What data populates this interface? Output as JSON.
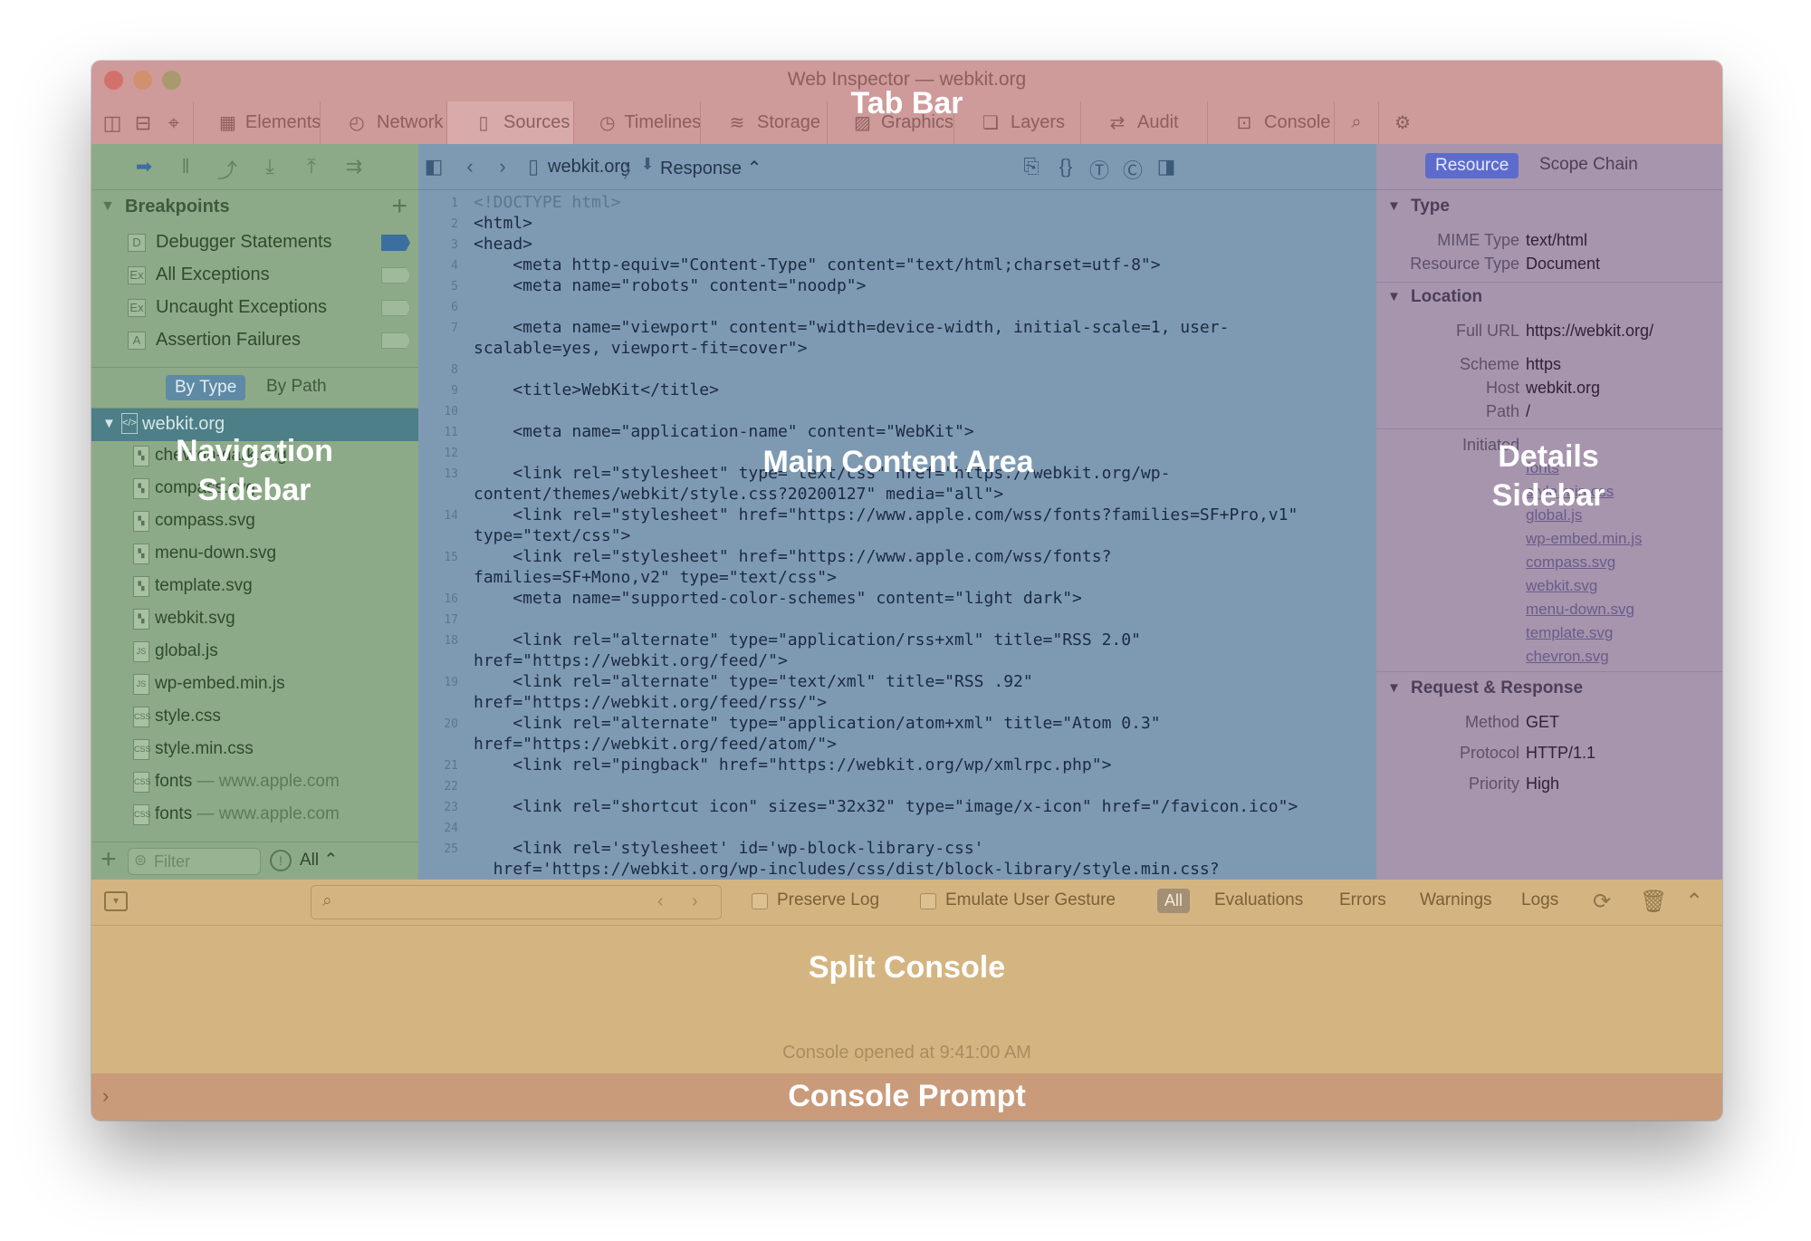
{
  "window": {
    "title": "Web Inspector — webkit.org"
  },
  "tabbar": {
    "tabs": [
      {
        "label": "Elements",
        "icon": "elements-icon"
      },
      {
        "label": "Network",
        "icon": "network-icon"
      },
      {
        "label": "Sources",
        "icon": "sources-icon",
        "active": true
      },
      {
        "label": "Timelines",
        "icon": "timelines-icon"
      },
      {
        "label": "Storage",
        "icon": "storage-icon"
      },
      {
        "label": "Graphics",
        "icon": "graphics-icon"
      },
      {
        "label": "Layers",
        "icon": "layers-icon"
      },
      {
        "label": "Audit",
        "icon": "audit-icon"
      },
      {
        "label": "Console",
        "icon": "console-icon"
      }
    ]
  },
  "overlay_labels": {
    "tab_bar": "Tab Bar",
    "navigation_sidebar": "Navigation Sidebar",
    "main_content": "Main Content Area",
    "details_sidebar": "Details Sidebar",
    "split_console": "Split Console",
    "console_prompt": "Console Prompt"
  },
  "nav": {
    "breakpoints_title": "Breakpoints",
    "breakpoints": [
      {
        "label": "Debugger Statements",
        "badge": "D",
        "enabled": true
      },
      {
        "label": "All Exceptions",
        "badge": "Ex",
        "enabled": false
      },
      {
        "label": "Uncaught Exceptions",
        "badge": "Ex",
        "enabled": false
      },
      {
        "label": "Assertion Failures",
        "badge": "A",
        "enabled": false
      }
    ],
    "group_by": {
      "by_type": "By Type",
      "by_path": "By Path"
    },
    "root": "webkit.org",
    "files": [
      {
        "name": "chevron-dark.svg",
        "kind": "svg"
      },
      {
        "name": "compass.svg",
        "kind": "svg"
      },
      {
        "name": "compass.svg",
        "kind": "svg"
      },
      {
        "name": "menu-down.svg",
        "kind": "svg"
      },
      {
        "name": "template.svg",
        "kind": "svg"
      },
      {
        "name": "webkit.svg",
        "kind": "svg"
      },
      {
        "name": "global.js",
        "kind": "JS"
      },
      {
        "name": "wp-embed.min.js",
        "kind": "JS"
      },
      {
        "name": "style.css",
        "kind": "CSS"
      },
      {
        "name": "style.min.css",
        "kind": "CSS"
      },
      {
        "name": "fonts",
        "domain": "— www.apple.com",
        "kind": "CSS"
      },
      {
        "name": "fonts",
        "domain": "— www.apple.com",
        "kind": "CSS"
      }
    ],
    "filter_placeholder": "Filter",
    "filter_scope": "All"
  },
  "main": {
    "breadcrumb": {
      "resource": "webkit.org",
      "mode": "Response"
    },
    "lines": [
      {
        "n": "1",
        "t": "<!DOCTYPE html>",
        "dim": true
      },
      {
        "n": "2",
        "t": "<html>"
      },
      {
        "n": "3",
        "t": "<head>"
      },
      {
        "n": "4",
        "t": "    <meta http-equiv=\"Content-Type\" content=\"text/html;charset=utf-8\">"
      },
      {
        "n": "5",
        "t": "    <meta name=\"robots\" content=\"noodp\">"
      },
      {
        "n": "6",
        "t": ""
      },
      {
        "n": "7",
        "t": "    <meta name=\"viewport\" content=\"width=device-width, initial-scale=1, user-"
      },
      {
        "n": "",
        "t": "scalable=yes, viewport-fit=cover\">"
      },
      {
        "n": "8",
        "t": ""
      },
      {
        "n": "9",
        "t": "    <title>WebKit</title>"
      },
      {
        "n": "10",
        "t": ""
      },
      {
        "n": "11",
        "t": "    <meta name=\"application-name\" content=\"WebKit\">"
      },
      {
        "n": "12",
        "t": ""
      },
      {
        "n": "13",
        "t": "    <link rel=\"stylesheet\" type=\"text/css\" href=\"https://webkit.org/wp-"
      },
      {
        "n": "",
        "t": "content/themes/webkit/style.css?20200127\" media=\"all\">"
      },
      {
        "n": "14",
        "t": "    <link rel=\"stylesheet\" href=\"https://www.apple.com/wss/fonts?families=SF+Pro,v1\""
      },
      {
        "n": "",
        "t": "type=\"text/css\">"
      },
      {
        "n": "15",
        "t": "    <link rel=\"stylesheet\" href=\"https://www.apple.com/wss/fonts?"
      },
      {
        "n": "",
        "t": "families=SF+Mono,v2\" type=\"text/css\">"
      },
      {
        "n": "16",
        "t": "    <meta name=\"supported-color-schemes\" content=\"light dark\">"
      },
      {
        "n": "17",
        "t": ""
      },
      {
        "n": "18",
        "t": "    <link rel=\"alternate\" type=\"application/rss+xml\" title=\"RSS 2.0\""
      },
      {
        "n": "",
        "t": "href=\"https://webkit.org/feed/\">"
      },
      {
        "n": "19",
        "t": "    <link rel=\"alternate\" type=\"text/xml\" title=\"RSS .92\""
      },
      {
        "n": "",
        "t": "href=\"https://webkit.org/feed/rss/\">"
      },
      {
        "n": "20",
        "t": "    <link rel=\"alternate\" type=\"application/atom+xml\" title=\"Atom 0.3\""
      },
      {
        "n": "",
        "t": "href=\"https://webkit.org/feed/atom/\">"
      },
      {
        "n": "21",
        "t": "    <link rel=\"pingback\" href=\"https://webkit.org/wp/xmlrpc.php\">"
      },
      {
        "n": "22",
        "t": ""
      },
      {
        "n": "23",
        "t": "    <link rel=\"shortcut icon\" sizes=\"32x32\" type=\"image/x-icon\" href=\"/favicon.ico\">"
      },
      {
        "n": "24",
        "t": ""
      },
      {
        "n": "25",
        "t": "    <link rel='stylesheet' id='wp-block-library-css'"
      },
      {
        "n": "",
        "t": "  href='https://webkit.org/wp-includes/css/dist/block-library/style.min.css?"
      }
    ]
  },
  "details": {
    "tabs": {
      "resource": "Resource",
      "scope_chain": "Scope Chain"
    },
    "type": {
      "title": "Type",
      "rows": [
        {
          "k": "MIME Type",
          "v": "text/html"
        },
        {
          "k": "Resource Type",
          "v": "Document"
        }
      ]
    },
    "location": {
      "title": "Location",
      "rows": [
        {
          "k": "Full URL",
          "v": "https://webkit.org/"
        },
        {
          "k": "Scheme",
          "v": "https"
        },
        {
          "k": "Host",
          "v": "webkit.org"
        },
        {
          "k": "Path",
          "v": "/"
        }
      ]
    },
    "initiated_label": "Initiated",
    "initiated": [
      "fonts",
      "style.min.css",
      "global.js",
      "wp-embed.min.js",
      "compass.svg",
      "webkit.svg",
      "menu-down.svg",
      "template.svg",
      "chevron.svg"
    ],
    "request": {
      "title": "Request & Response",
      "rows": [
        {
          "k": "Method",
          "v": "GET"
        },
        {
          "k": "Protocol",
          "v": "HTTP/1.1"
        },
        {
          "k": "Priority",
          "v": "High"
        }
      ]
    }
  },
  "console": {
    "search_placeholder": "",
    "preserve_log": "Preserve Log",
    "emulate_gesture": "Emulate User Gesture",
    "filters": [
      "All",
      "Evaluations",
      "Errors",
      "Warnings",
      "Logs"
    ],
    "message": "Console opened at 9:41:00 AM"
  },
  "colors": {
    "tab_bar": "#ce9a9a",
    "navigation_sidebar": "#8daa88",
    "main_content": "#7e9ab3",
    "details_sidebar": "#a695ad",
    "split_console": "#d4b581",
    "console_prompt": "#c99b7b"
  }
}
